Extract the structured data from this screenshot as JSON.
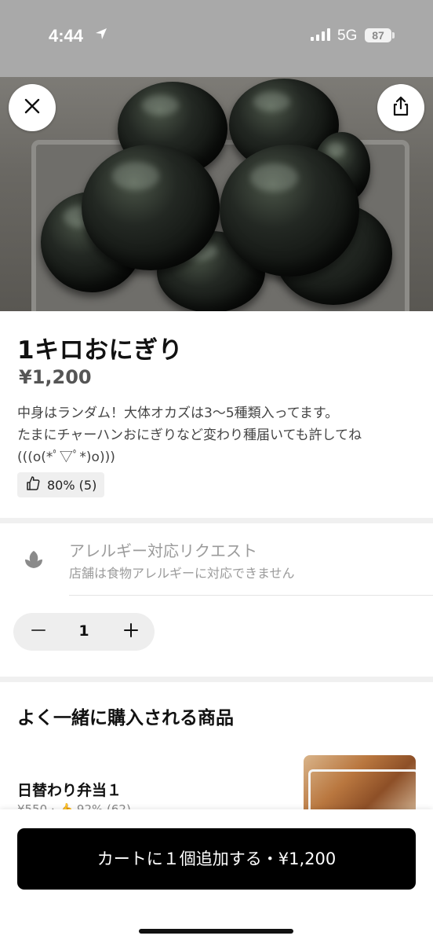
{
  "status_bar": {
    "time": "4:44",
    "network": "5G",
    "battery": "87"
  },
  "product": {
    "name": "1キロおにぎり",
    "price": "¥1,200",
    "description_lines": [
      "中身はランダム！大体オカズは3〜5種類入ってます。",
      "たまにチャーハンおにぎりなど変わり種届いても許してね",
      "(((o(*ﾟ▽ﾟ*)o)))"
    ],
    "rating": "80% (5)"
  },
  "allergy": {
    "title": "アレルギー対応リクエスト",
    "subtitle": "店舗は食物アレルギーに対応できません"
  },
  "quantity": {
    "value": "1"
  },
  "frequently_bought": {
    "title": "よく一緒に購入される商品",
    "items": [
      {
        "name": "日替わり弁当１",
        "meta": "¥550 · 👍 92% (62)"
      }
    ]
  },
  "cart_button": {
    "label": "カートに１個追加する・¥1,200"
  },
  "colors": {
    "accent": "#000000",
    "status_bar_bg": "#a9a9a9",
    "muted_text": "#9b9b9b"
  },
  "icons": {
    "close": "close-icon",
    "share": "share-icon",
    "thumbs_up": "thumbs-up-icon",
    "allergy": "leaf-icon",
    "minus": "minus-icon",
    "plus": "plus-icon"
  }
}
